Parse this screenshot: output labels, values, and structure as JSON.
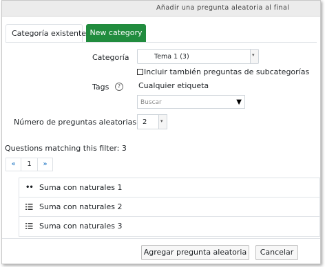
{
  "dialog": {
    "title": "Añadir una pregunta aleatoria al final",
    "tabs": [
      {
        "label": "Categoría existente",
        "active": true
      },
      {
        "label": "New category",
        "active": false
      }
    ]
  },
  "form": {
    "category_label": "Categoría",
    "category_value": "Tema 1 (3)",
    "include_subcategories_label": "Incluir también preguntas de subcategorías",
    "include_subcategories_checked": false,
    "tags_label": "Tags",
    "tags_value": "Cualquier etiqueta",
    "search_placeholder": "Buscar",
    "number_label": "Número de preguntas aleatorias",
    "number_value": "2"
  },
  "results": {
    "matching_text": "Questions matching this filter: 3",
    "pagination": {
      "prev": "«",
      "current": "1",
      "next": "»"
    },
    "questions": [
      {
        "name": "Suma con naturales 1",
        "icon": "drag-drop-icon"
      },
      {
        "name": "Suma con naturales 2",
        "icon": "multichoice-list-icon"
      },
      {
        "name": "Suma con naturales 3",
        "icon": "multichoice-list-icon"
      }
    ]
  },
  "footer": {
    "add_label": "Agregar pregunta aleatoria",
    "cancel_label": "Cancelar"
  },
  "colors": {
    "tab_green": "#218c3e",
    "link_blue": "#0f6cbf"
  }
}
